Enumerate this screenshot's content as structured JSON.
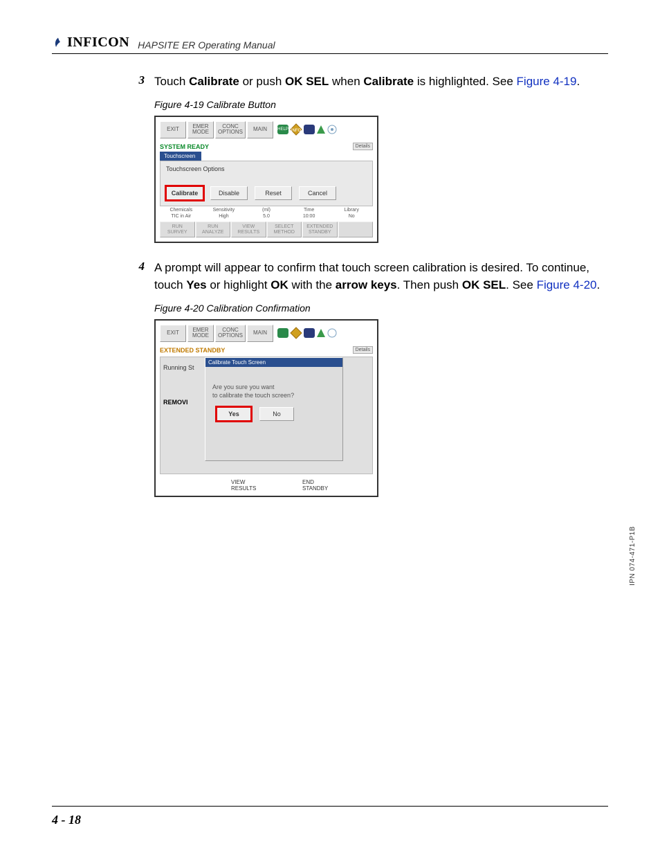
{
  "header": {
    "logo_text": "INFICON",
    "manual_title": "HAPSITE ER Operating Manual"
  },
  "steps": {
    "s3": {
      "num": "3",
      "t1": "Touch ",
      "b1": "Calibrate",
      "t2": " or push ",
      "b2": "OK SEL",
      "t3": " when ",
      "b3": "Calibrate",
      "t4": " is highlighted. See ",
      "link": "Figure 4-19",
      "t5": "."
    },
    "s4": {
      "num": "4",
      "t1": "A prompt will appear to confirm that touch screen calibration is desired. To continue, touch ",
      "b1": "Yes",
      "t2": " or highlight ",
      "b2": "OK",
      "t3": " with the ",
      "b3": "arrow keys",
      "t4": ". Then push ",
      "b4": "OK SEL",
      "t5": ". See ",
      "link": "Figure 4-20",
      "t6": "."
    }
  },
  "fig1": {
    "caption": "Figure 4-19  Calibrate Button",
    "toolbar": {
      "exit": "EXIT",
      "emer": "EMER\nMODE",
      "conc": "CONC\nOPTIONS",
      "main": "MAIN"
    },
    "icons": {
      "help": "HELP",
      "info": "INFO"
    },
    "status": "SYSTEM READY",
    "details": "Details",
    "tab": "Touchscreen",
    "panel_title": "Touchscreen Options",
    "buttons": {
      "calibrate": "Calibrate",
      "disable": "Disable",
      "reset": "Reset",
      "cancel": "Cancel"
    },
    "info": {
      "c1a": "Chemicals",
      "c1b": "TIC in Air",
      "c2a": "Sensitivity",
      "c2b": "High",
      "c3a": "(ml)",
      "c3b": "5.0",
      "c4a": "Time",
      "c4b": "10:00",
      "c5a": "Library",
      "c5b": "No"
    },
    "bottom": {
      "b1": "RUN\nSURVEY",
      "b2": "RUN\nANALYZE",
      "b3": "VIEW\nRESULTS",
      "b4": "SELECT\nMETHOD",
      "b5": "EXTENDED\nSTANDBY"
    }
  },
  "fig2": {
    "caption": "Figure 4-20  Calibration Confirmation",
    "toolbar": {
      "exit": "EXIT",
      "emer": "EMER\nMODE",
      "conc": "CONC\nOPTIONS",
      "main": "MAIN"
    },
    "status": "EXTENDED STANDBY",
    "details": "Details",
    "under1": "Running St",
    "under2": "REMOVI",
    "modal_title": "Calibrate Touch Screen",
    "modal_msg1": "Are you sure you want",
    "modal_msg2": "to calibrate the touch screen?",
    "yes": "Yes",
    "no": "No",
    "bottom": {
      "b3": "VIEW\nRESULTS",
      "b5": "END\nSTANDBY"
    }
  },
  "footer": {
    "pagenum": "4 - 18",
    "ipn": "IPN 074-471-P1B"
  }
}
